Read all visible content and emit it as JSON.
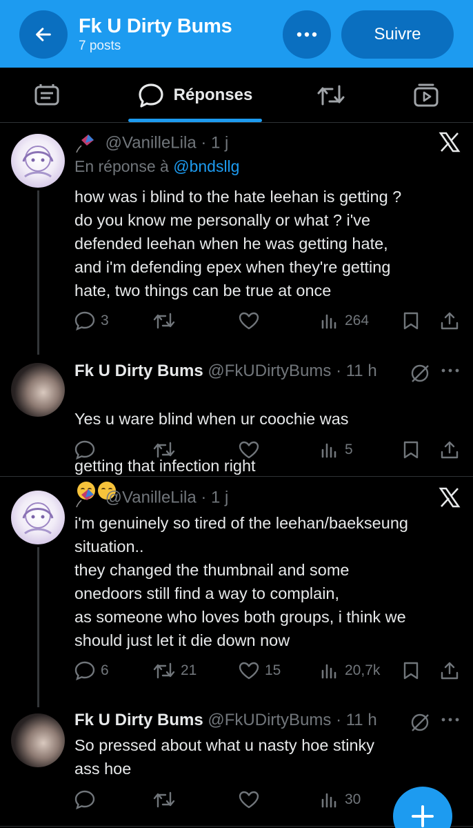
{
  "header": {
    "title": "Fk U Dirty Bums",
    "subtitle": "7 posts",
    "follow_label": "Suivre"
  },
  "tabs": {
    "active_label": "Réponses",
    "items": [
      "posts-tab-icon",
      "replies-tab-icon",
      "reposts-tab-icon",
      "media-tab-icon"
    ]
  },
  "colors": {
    "accent": "#1d9bf0",
    "background": "#000000",
    "muted": "#71767b"
  },
  "posts": [
    {
      "author_handle": "@VanilleLila",
      "time": "· 1 j",
      "reply_prefix": "En réponse à",
      "reply_handle": "@bndsllg",
      "text": "how was i blind to the hate leehan is getting ?\ndo you know me personally or what ? i've\ndefended leehan when he was getting hate,\nand i'm defending epex when they're getting\nhate, two things can be true at once",
      "replies": "3",
      "reposts": "",
      "likes": "",
      "views": "264"
    },
    {
      "author_name": "Fk U Dirty Bums",
      "author_handle": "@FkUDirtyBums",
      "time": "· 11 h",
      "text_line1": "Yes u ware blind when ur coochie was",
      "text_line2": "getting that infection right",
      "replies": "",
      "reposts": "",
      "likes": "",
      "views": "5"
    },
    {
      "author_handle": "@VanilleLila",
      "time": "· 1 j",
      "text": "i'm genuinely so tired of the leehan/baekseung\nsituation..\nthey changed the thumbnail and some\nonedoors still find a way to complain,\nas someone who loves both groups, i think we\nshould just let it die down now",
      "replies": "6",
      "reposts": "21",
      "likes": "15",
      "views": "20,7k"
    },
    {
      "author_name": "Fk U Dirty Bums",
      "author_handle": "@FkUDirtyBums",
      "time": "· 11 h",
      "text": "So pressed about what u nasty hoe stinky\nass hoe",
      "replies": "",
      "reposts": "",
      "likes": "",
      "views": "30"
    }
  ]
}
